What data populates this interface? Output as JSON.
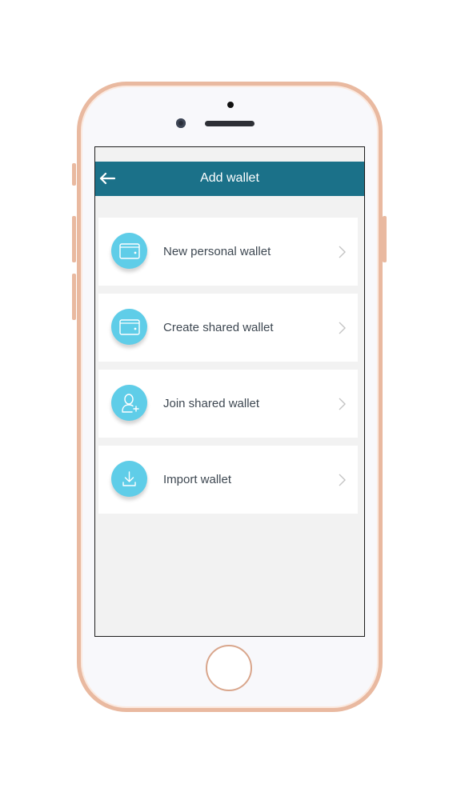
{
  "header": {
    "title": "Add wallet",
    "back_icon": "arrow-left-icon"
  },
  "menu": {
    "items": [
      {
        "label": "New personal wallet",
        "icon": "wallet-icon"
      },
      {
        "label": "Create shared wallet",
        "icon": "wallet-icon"
      },
      {
        "label": "Join shared wallet",
        "icon": "add-user-icon"
      },
      {
        "label": "Import wallet",
        "icon": "download-icon"
      }
    ]
  },
  "colors": {
    "header": "#1b7189",
    "icon_circle": "#5fcde8",
    "background": "#f2f2f2",
    "phone_frame": "#e9b9a0"
  }
}
